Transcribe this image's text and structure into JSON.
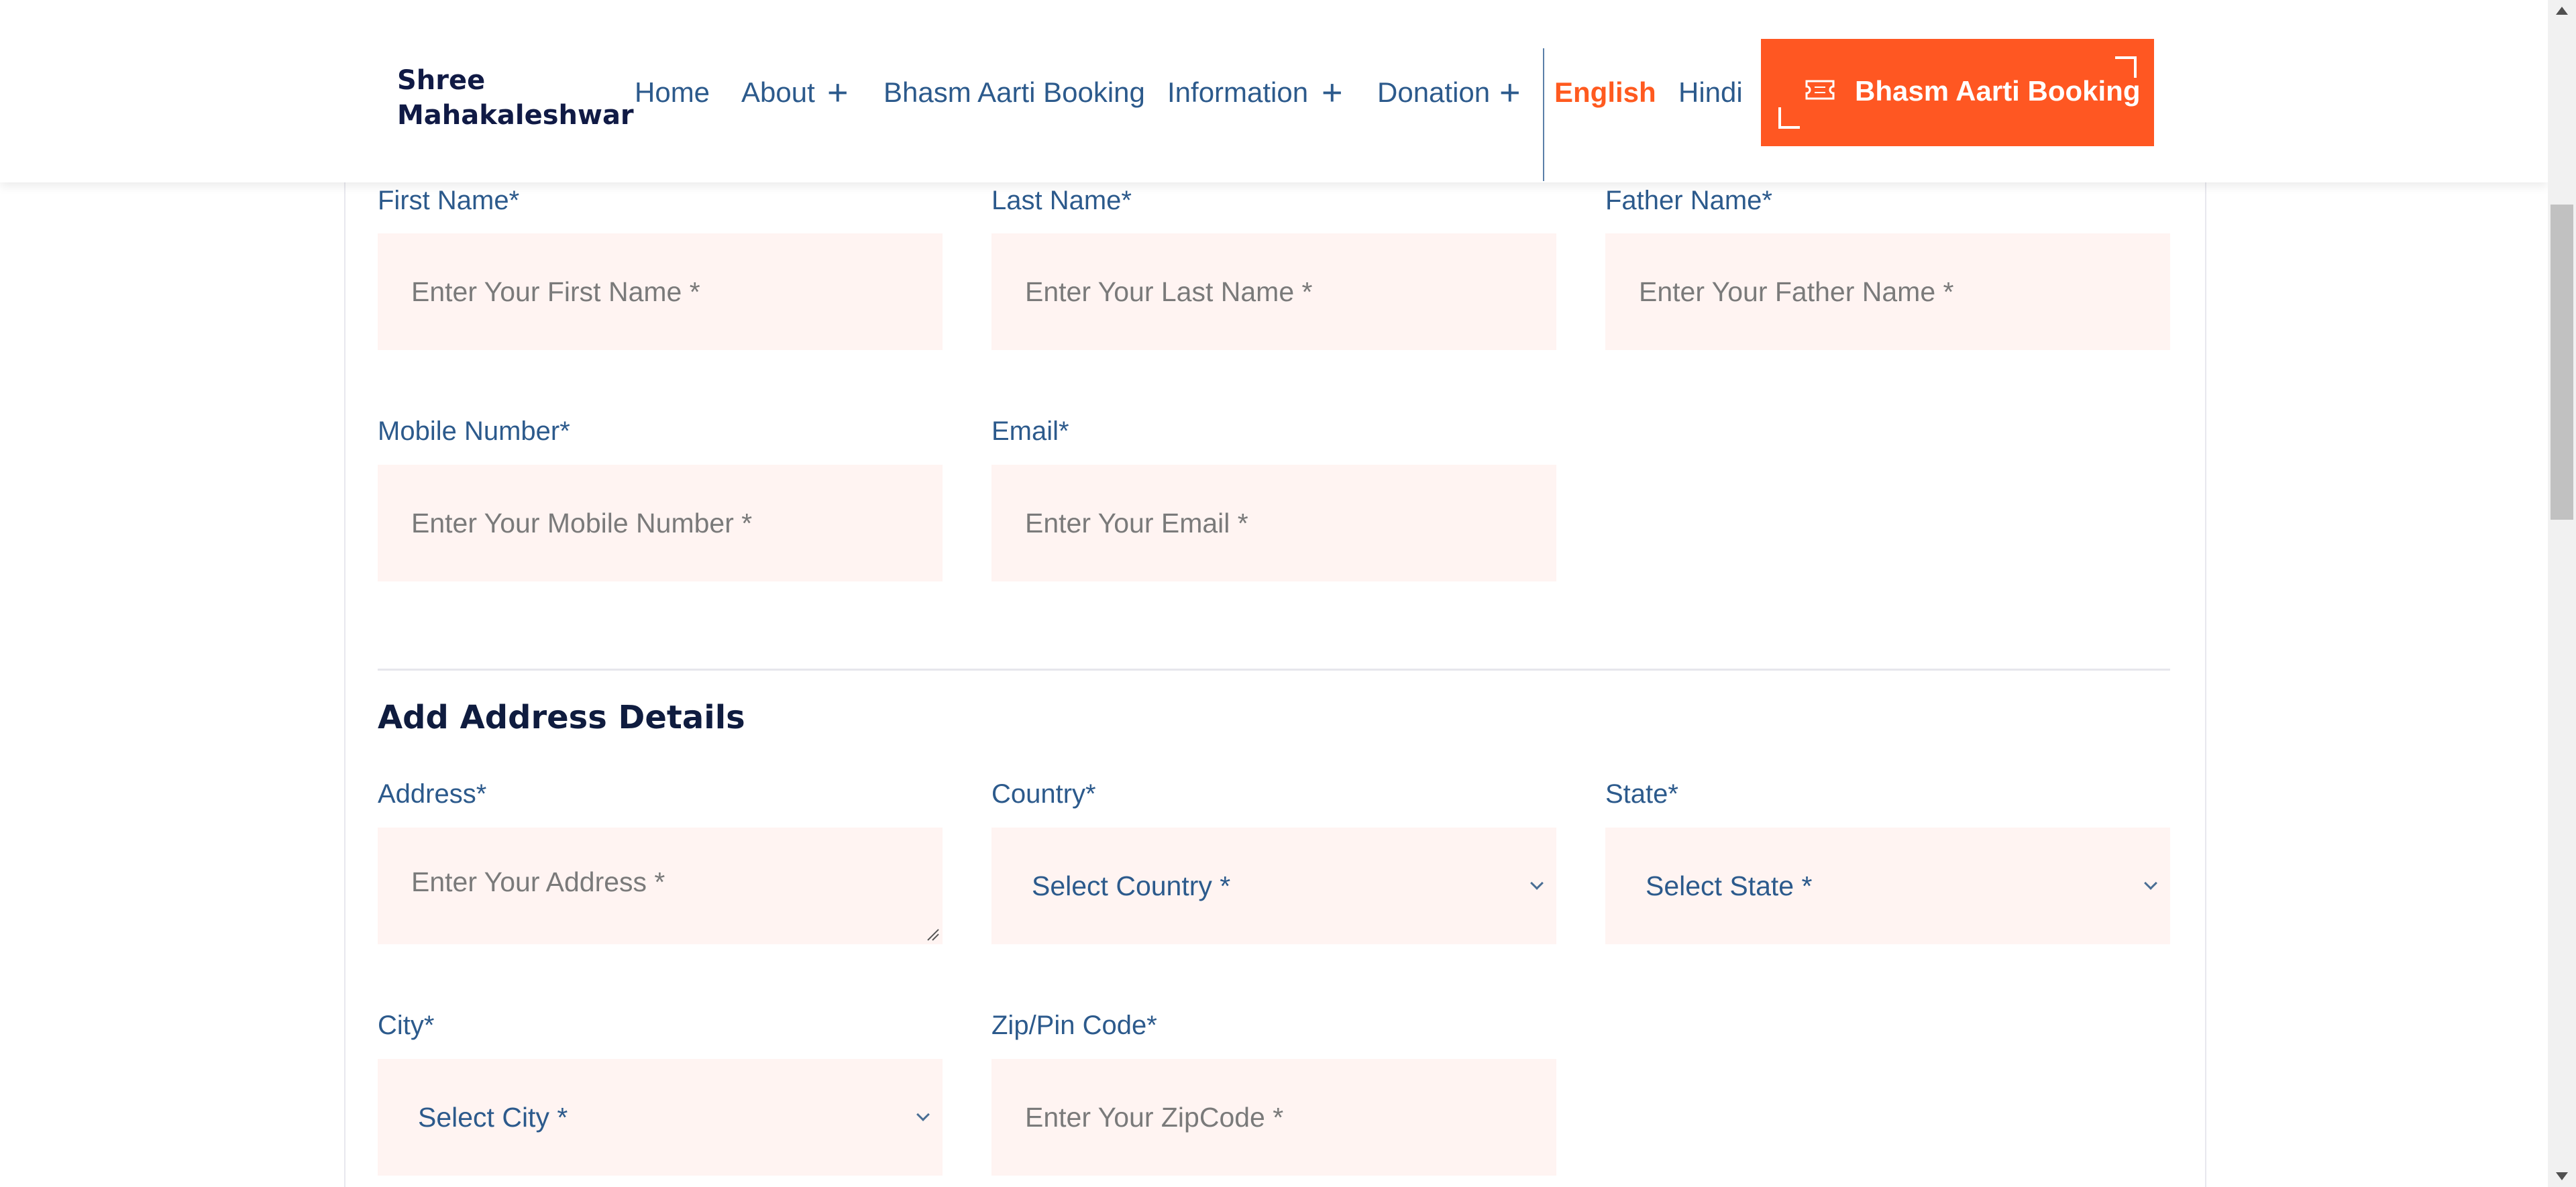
{
  "header": {
    "logo_line1": "Shree",
    "logo_line2": "Mahakaleshwar",
    "nav": {
      "home": "Home",
      "about": "About",
      "bhasm_aarti_booking": "Bhasm Aarti Booking",
      "information": "Information",
      "donation": "Donation"
    },
    "plus_glyph": "+",
    "languages": {
      "english": "English",
      "hindi": "Hindi"
    },
    "cta_label": "Bhasm Aarti Booking",
    "accent_color": "#ff5722"
  },
  "form": {
    "personal": {
      "first_name": {
        "label": "First Name*",
        "placeholder": "Enter Your First Name *"
      },
      "last_name": {
        "label": "Last Name*",
        "placeholder": "Enter Your Last Name *"
      },
      "father_name": {
        "label": "Father Name*",
        "placeholder": "Enter Your Father Name *"
      },
      "mobile": {
        "label": "Mobile Number*",
        "placeholder": "Enter Your Mobile Number *"
      },
      "email": {
        "label": "Email*",
        "placeholder": "Enter Your Email *"
      }
    },
    "address_section_title": "Add Address Details",
    "address": {
      "address": {
        "label": "Address*",
        "placeholder": "Enter Your Address *"
      },
      "country": {
        "label": "Country*",
        "selected": "Select Country *"
      },
      "state": {
        "label": "State*",
        "selected": "Select State *"
      },
      "city": {
        "label": "City*",
        "selected": "Select City *"
      },
      "zip": {
        "label": "Zip/Pin Code*",
        "placeholder": "Enter Your ZipCode *"
      }
    }
  }
}
